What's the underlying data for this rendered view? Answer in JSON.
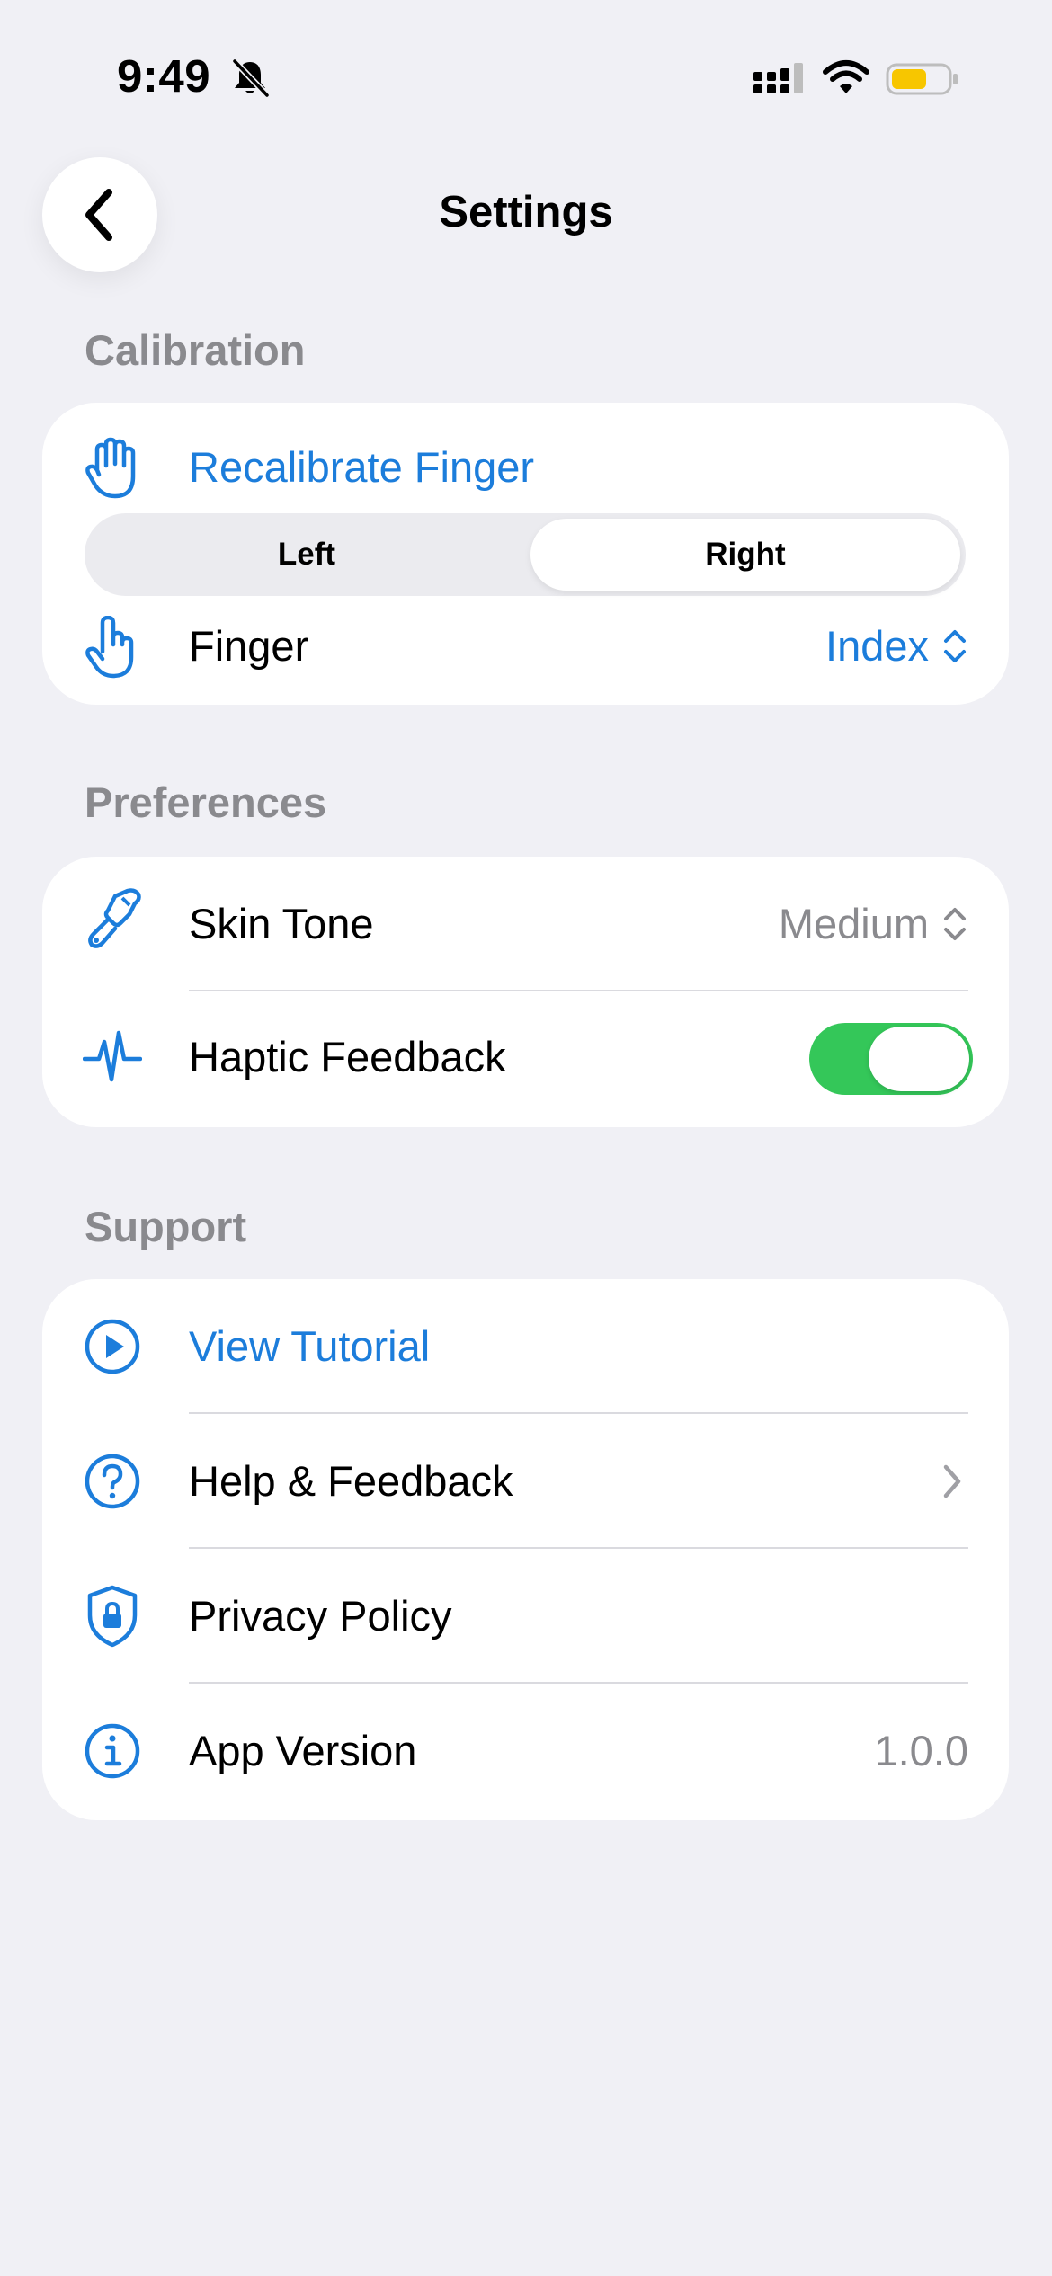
{
  "status_bar": {
    "time": "9:49",
    "icons": [
      "bell-slash-icon",
      "cellular-signal-icon",
      "wifi-icon",
      "battery-icon"
    ],
    "battery_color": "#F7C600"
  },
  "nav": {
    "back_icon": "chevron-left-icon",
    "title": "Settings"
  },
  "sections": {
    "calibration": {
      "header": "Calibration",
      "recalibrate": {
        "icon": "hand-raised-icon",
        "label": "Recalibrate Finger"
      },
      "hand_selector": {
        "options": [
          "Left",
          "Right"
        ],
        "selected": "Right"
      },
      "finger": {
        "icon": "hand-point-up-icon",
        "label": "Finger",
        "value": "Index"
      }
    },
    "preferences": {
      "header": "Preferences",
      "skin_tone": {
        "icon": "paintbrush-icon",
        "label": "Skin Tone",
        "value": "Medium"
      },
      "haptic": {
        "icon": "waveform-pulse-icon",
        "label": "Haptic Feedback",
        "enabled": true
      }
    },
    "support": {
      "header": "Support",
      "tutorial": {
        "icon": "play-circle-icon",
        "label": "View Tutorial"
      },
      "help": {
        "icon": "question-circle-icon",
        "label": "Help & Feedback"
      },
      "privacy": {
        "icon": "lock-shield-icon",
        "label": "Privacy Policy"
      },
      "version": {
        "icon": "info-circle-icon",
        "label": "App Version",
        "value": "1.0.0"
      }
    }
  },
  "colors": {
    "background": "#F0F0F5",
    "accent_blue": "#1C7DDB",
    "toggle_on": "#34C759",
    "secondary_text": "#8A8A8E"
  }
}
